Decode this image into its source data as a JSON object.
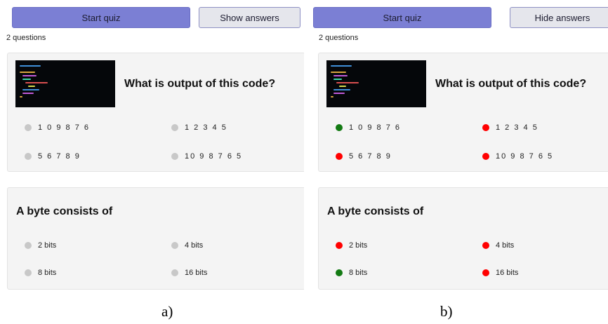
{
  "colors": {
    "correct": "#137a13",
    "wrong": "#ff0000",
    "neutral": "#c8c8c8",
    "primary": "#7b7fd4"
  },
  "panels": [
    {
      "start_label": "Start quiz",
      "toggle_label": "Show answers",
      "count": "2 questions",
      "caption": "a)",
      "answers_shown": false
    },
    {
      "start_label": "Start quiz",
      "toggle_label": "Hide answers",
      "count": "2 questions",
      "caption": "b)",
      "answers_shown": true
    }
  ],
  "questions": [
    {
      "title": "What is output of this code?",
      "has_code_image": true,
      "options": [
        {
          "text": "1 0 9 8 7 6",
          "correct": true
        },
        {
          "text": "1 2 3 4 5",
          "correct": false
        },
        {
          "text": "5 6 7 8 9",
          "correct": false
        },
        {
          "text": "10 9 8 7 6 5",
          "correct": false
        }
      ]
    },
    {
      "title": "A byte consists of",
      "has_code_image": false,
      "options": [
        {
          "text": "2 bits",
          "correct": false
        },
        {
          "text": "4 bits",
          "correct": false
        },
        {
          "text": "8 bits",
          "correct": true
        },
        {
          "text": "16 bits",
          "correct": false
        }
      ]
    }
  ]
}
